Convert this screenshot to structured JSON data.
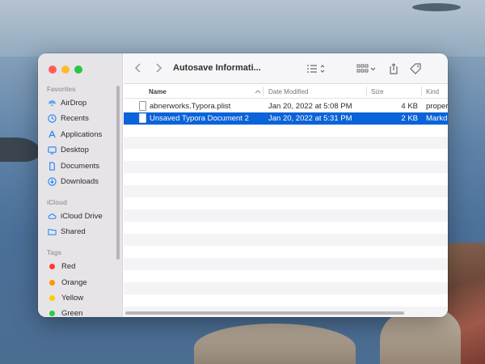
{
  "window": {
    "title": "Autosave Informati..."
  },
  "sidebar": {
    "favorites_label": "Favorites",
    "favorites": [
      {
        "label": "AirDrop",
        "icon": "airdrop-icon"
      },
      {
        "label": "Recents",
        "icon": "clock-icon"
      },
      {
        "label": "Applications",
        "icon": "applications-icon"
      },
      {
        "label": "Desktop",
        "icon": "desktop-icon"
      },
      {
        "label": "Documents",
        "icon": "document-icon"
      },
      {
        "label": "Downloads",
        "icon": "download-icon"
      }
    ],
    "icloud_label": "iCloud",
    "icloud": [
      {
        "label": "iCloud Drive",
        "icon": "cloud-icon"
      },
      {
        "label": "Shared",
        "icon": "shared-folder-icon"
      }
    ],
    "tags_label": "Tags",
    "tags": [
      {
        "label": "Red",
        "color": "#ff3b30"
      },
      {
        "label": "Orange",
        "color": "#ff9500"
      },
      {
        "label": "Yellow",
        "color": "#ffcc00"
      },
      {
        "label": "Green",
        "color": "#28cd41"
      }
    ]
  },
  "columns": {
    "name": "Name",
    "date": "Date Modified",
    "size": "Size",
    "kind": "Kind"
  },
  "files": [
    {
      "name": "abnerworks.Typora.plist",
      "date": "Jan 20, 2022 at 5:08 PM",
      "size": "4 KB",
      "kind": "proper"
    },
    {
      "name": "Unsaved Typora Document 2",
      "date": "Jan 20, 2022 at 5:31 PM",
      "size": "2 KB",
      "kind": "Markd"
    }
  ],
  "colors": {
    "selection": "#0a63d8",
    "accent": "#0a7aff"
  }
}
